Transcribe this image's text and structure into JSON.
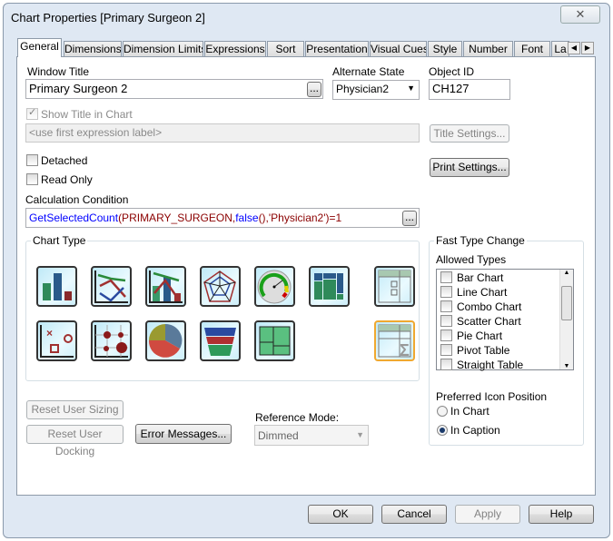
{
  "window": {
    "title": "Chart Properties [Primary Surgeon 2]",
    "close_icon": "close-icon"
  },
  "tabs": [
    "General",
    "Dimensions",
    "Dimension Limits",
    "Expressions",
    "Sort",
    "Presentation",
    "Visual Cues",
    "Style",
    "Number",
    "Font",
    "La"
  ],
  "active_tab": "General",
  "general": {
    "window_title_label": "Window Title",
    "window_title_value": "Primary Surgeon 2",
    "ellipsis": "...",
    "alternate_state_label": "Alternate State",
    "alternate_state_value": "Physician2",
    "object_id_label": "Object ID",
    "object_id_value": "CH127",
    "show_title_label": "Show Title in Chart",
    "show_title_checked": true,
    "title_placeholder": "<use first expression label>",
    "title_settings": "Title Settings...",
    "print_settings": "Print Settings...",
    "detached_label": "Detached",
    "read_only_label": "Read Only",
    "calc_condition_label": "Calculation Condition",
    "calc_condition_parts": [
      "GetSelectedCount",
      "(PRIMARY_SURGEON,",
      "false",
      "(),",
      "'Physician2'",
      ")=1"
    ],
    "chart_type_label": "Chart Type",
    "chart_types": [
      "bar",
      "line",
      "combo",
      "radar",
      "gauge",
      "mekko",
      "pivot-table",
      "scatter",
      "grid",
      "pie",
      "funnel",
      "block",
      "straight-table"
    ],
    "selected_chart_type": "straight-table",
    "fast_type_change_label": "Fast Type Change",
    "allowed_types_label": "Allowed Types",
    "allowed_types": [
      "Bar Chart",
      "Line Chart",
      "Combo Chart",
      "Scatter Chart",
      "Pie Chart",
      "Pivot Table",
      "Straight Table"
    ],
    "preferred_icon_label": "Preferred Icon Position",
    "icon_positions": [
      "In Chart",
      "In Caption"
    ],
    "icon_position_selected": "In Caption",
    "reset_user_sizing": "Reset User Sizing",
    "reset_user_docking": "Reset User Docking",
    "error_messages": "Error Messages...",
    "reference_mode_label": "Reference Mode:",
    "reference_mode_value": "Dimmed"
  },
  "footer": {
    "ok": "OK",
    "cancel": "Cancel",
    "apply": "Apply",
    "help": "Help"
  },
  "colors": {
    "expression_function": "#0000ff",
    "expression_string": "#8b0000",
    "selected_tile": "#f0a830"
  }
}
